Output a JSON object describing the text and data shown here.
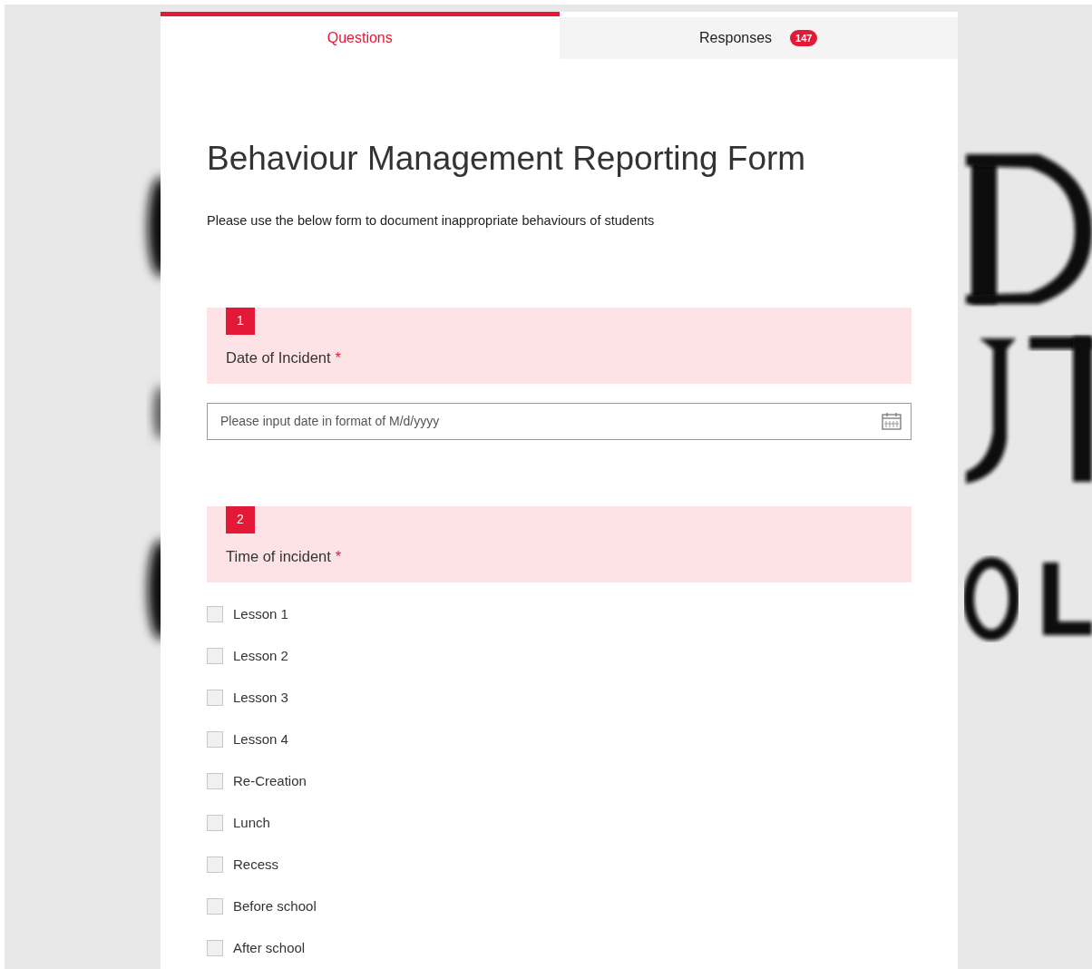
{
  "tabs": [
    {
      "label": "Questions",
      "selected": true
    },
    {
      "label": "Responses",
      "selected": false,
      "badge": "147"
    }
  ],
  "form": {
    "title": "Behaviour Management Reporting Form",
    "description": "Please use the below form to document inappropriate behaviours of students"
  },
  "questions": [
    {
      "kind": "date",
      "number": "1",
      "label": "Date of Incident",
      "required_mark": "*",
      "placeholder": "Please input date in format of M/d/yyyy"
    },
    {
      "kind": "checkboxes",
      "number": "2",
      "label": "Time of incident",
      "required_mark": "*",
      "options": [
        {
          "label": "Lesson 1",
          "checked": false
        },
        {
          "label": "Lesson 2",
          "checked": false
        },
        {
          "label": "Lesson 3",
          "checked": false
        },
        {
          "label": "Lesson 4",
          "checked": false
        },
        {
          "label": "Re-Creation",
          "checked": false
        },
        {
          "label": "Lunch",
          "checked": false
        },
        {
          "label": "Recess",
          "checked": false
        },
        {
          "label": "Before school",
          "checked": false
        },
        {
          "label": "After school",
          "checked": false
        }
      ]
    }
  ]
}
